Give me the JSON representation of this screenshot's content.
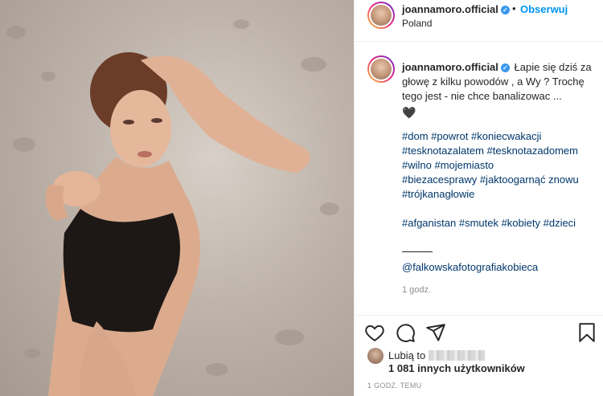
{
  "post": {
    "username": "joannamoro.official",
    "follow_label": "Obserwuj",
    "location": "Poland",
    "dot": "•",
    "verified_icon": "verified-badge-icon",
    "photo_alt": "photo-of-woman-on-sand"
  },
  "caption": {
    "username": "joannamoro.official",
    "text": "Łapie się dziś za głowę z kilku powodów , a Wy ? Trochę tego jest - nie chce banalizowac ...",
    "heart": "🖤",
    "tags_line1": "#dom #powrot #koniecwakacji",
    "tags_line2": "#tesknotazalatem #tesknotazadomem",
    "tags_line3": "#wilno #mojemiasto",
    "tags_line4a": "#biezacesprawy #jaktoogarnąć",
    "tags_line4b": "znowu",
    "tags_line5": "#trójkanagłowie",
    "tags_line6": "#afganistan #smutek #kobiety #dzieci",
    "mention": "@falkowskafotografiakobieca",
    "time": "1 godz."
  },
  "actions": {
    "like_icon": "heart-outline-icon",
    "comment_icon": "comment-icon",
    "share_icon": "send-icon",
    "save_icon": "bookmark-icon",
    "liked_by_prefix": "Lubią to",
    "others": "1 081 innych użytkowników",
    "timestamp": "1 GODZ. TEMU"
  },
  "colors": {
    "link": "#0095f6",
    "hashtag": "#00376b",
    "muted": "#8e8e8e",
    "text": "#262626"
  }
}
